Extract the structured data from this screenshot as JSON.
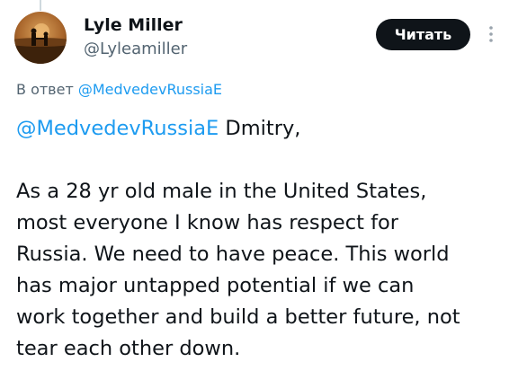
{
  "author": {
    "display_name": "Lyle Miller",
    "handle": "@Lyleamiller"
  },
  "actions": {
    "read_label": "Читать",
    "more_icon": "more-vertical-icon"
  },
  "reply": {
    "prefix": "В ответ",
    "mention": "@MedvedevRussiaE"
  },
  "tweet": {
    "mention": "@MedvedevRussiaE",
    "greeting": "Dmitry,",
    "lines": [
      "As a 28 yr old male in the United States,",
      "most everyone I know has respect for",
      "Russia. We need to have peace. This world",
      "has major untapped potential if we can",
      "work together and build a better future, not",
      "tear each other down."
    ]
  },
  "colors": {
    "link": "#1d9bf0",
    "text": "#0f1419",
    "secondary": "#536471",
    "button_bg": "#0f1419"
  }
}
